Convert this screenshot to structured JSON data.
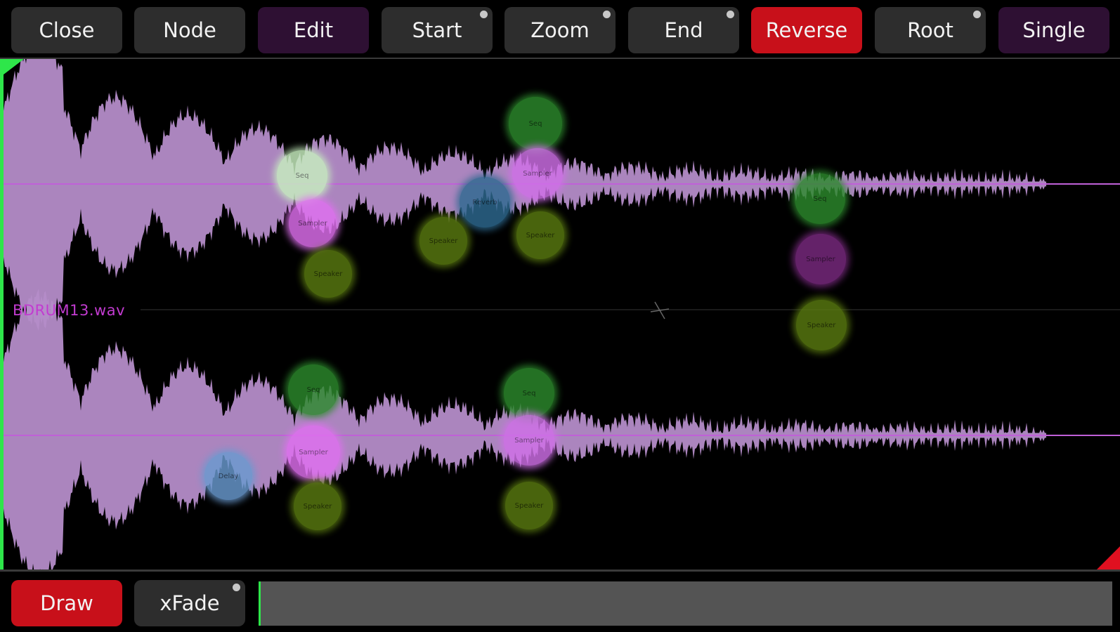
{
  "toolbar": {
    "buttons": [
      {
        "label": "Close",
        "style": "gray",
        "has_dot": false
      },
      {
        "label": "Node",
        "style": "gray",
        "has_dot": false
      },
      {
        "label": "Edit",
        "style": "purple",
        "has_dot": false
      },
      {
        "label": "Start",
        "style": "gray",
        "has_dot": true
      },
      {
        "label": "Zoom",
        "style": "gray",
        "has_dot": true
      },
      {
        "label": "End",
        "style": "gray",
        "has_dot": true
      },
      {
        "label": "Reverse",
        "style": "red",
        "has_dot": false
      },
      {
        "label": "Root",
        "style": "gray",
        "has_dot": true
      },
      {
        "label": "Single",
        "style": "purple",
        "has_dot": false
      }
    ]
  },
  "waveform": {
    "file_name": "BDRUM13.wav",
    "wave_color": "#b48cc8",
    "line_color": "#c060d8",
    "nodes": [
      {
        "label": "Seq",
        "color": "#2d8a2d",
        "channel": 0
      },
      {
        "label": "Seq",
        "color": "#c8f0c0",
        "channel": 0
      },
      {
        "label": "Sampler",
        "color": "#e070f0",
        "channel": 0
      },
      {
        "label": "Speaker",
        "color": "#5a7a10",
        "channel": 0
      },
      {
        "label": "Sampler",
        "color": "#d070e8",
        "channel": 0
      },
      {
        "label": "Reverb",
        "color": "#2e6a90",
        "channel": 0
      },
      {
        "label": "Speaker",
        "color": "#5a7a10",
        "channel": 0
      },
      {
        "label": "Speaker",
        "color": "#5a7a10",
        "channel": 0
      },
      {
        "label": "Seq",
        "color": "#2d8a2d",
        "channel": 0
      },
      {
        "label": "Sampler",
        "color": "#7a2a80",
        "channel": 0
      },
      {
        "label": "Speaker",
        "color": "#5a7a10",
        "channel": 0
      },
      {
        "label": "Seq",
        "color": "#2d8a2d",
        "channel": 1
      },
      {
        "label": "Seq",
        "color": "#2d8a2d",
        "channel": 1
      },
      {
        "label": "Sampler",
        "color": "#e070f0",
        "channel": 1
      },
      {
        "label": "Delay",
        "color": "#6a9ad0",
        "channel": 1
      },
      {
        "label": "Speaker",
        "color": "#5a7a10",
        "channel": 1
      },
      {
        "label": "Sampler",
        "color": "#d070e8",
        "channel": 1
      },
      {
        "label": "Speaker",
        "color": "#5a7a10",
        "channel": 1
      }
    ]
  },
  "bottom": {
    "draw_label": "Draw",
    "xfade_label": "xFade"
  },
  "colors": {
    "accent_red": "#c8101a",
    "accent_purple": "#2e1033",
    "green_marker": "#2ee64a",
    "red_marker": "#e01020"
  }
}
